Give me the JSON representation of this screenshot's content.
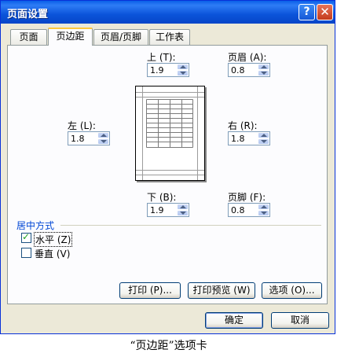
{
  "window": {
    "title": "页面设置",
    "help_label": "?",
    "close_label": "✕"
  },
  "tabs": [
    {
      "label": "页面",
      "active": false
    },
    {
      "label": "页边距",
      "active": true
    },
    {
      "label": "页眉/页脚",
      "active": false
    },
    {
      "label": "工作表",
      "active": false
    }
  ],
  "margins": {
    "top": {
      "label": "上 (T):",
      "value": "1.9"
    },
    "header": {
      "label": "页眉 (A):",
      "value": "0.8"
    },
    "left": {
      "label": "左 (L):",
      "value": "1.8"
    },
    "right": {
      "label": "右 (R):",
      "value": "1.8"
    },
    "bottom": {
      "label": "下 (B):",
      "value": "1.9"
    },
    "footer": {
      "label": "页脚 (F):",
      "value": "0.8"
    }
  },
  "centering": {
    "group_label": "居中方式",
    "horizontal": {
      "label": "水平 (Z)",
      "checked": true
    },
    "vertical": {
      "label": "垂直 (V)",
      "checked": false
    }
  },
  "panel_buttons": {
    "print": "打印 (P)...",
    "print_preview": "打印预览 (W)",
    "options": "选项 (O)..."
  },
  "footer_buttons": {
    "ok": "确定",
    "cancel": "取消"
  },
  "caption": "“页边距”选项卡",
  "colors": {
    "titlebar": "#0B54DA",
    "group_label": "#0046D5",
    "tab_highlight": "#FFC83C",
    "check": "#21A121"
  }
}
